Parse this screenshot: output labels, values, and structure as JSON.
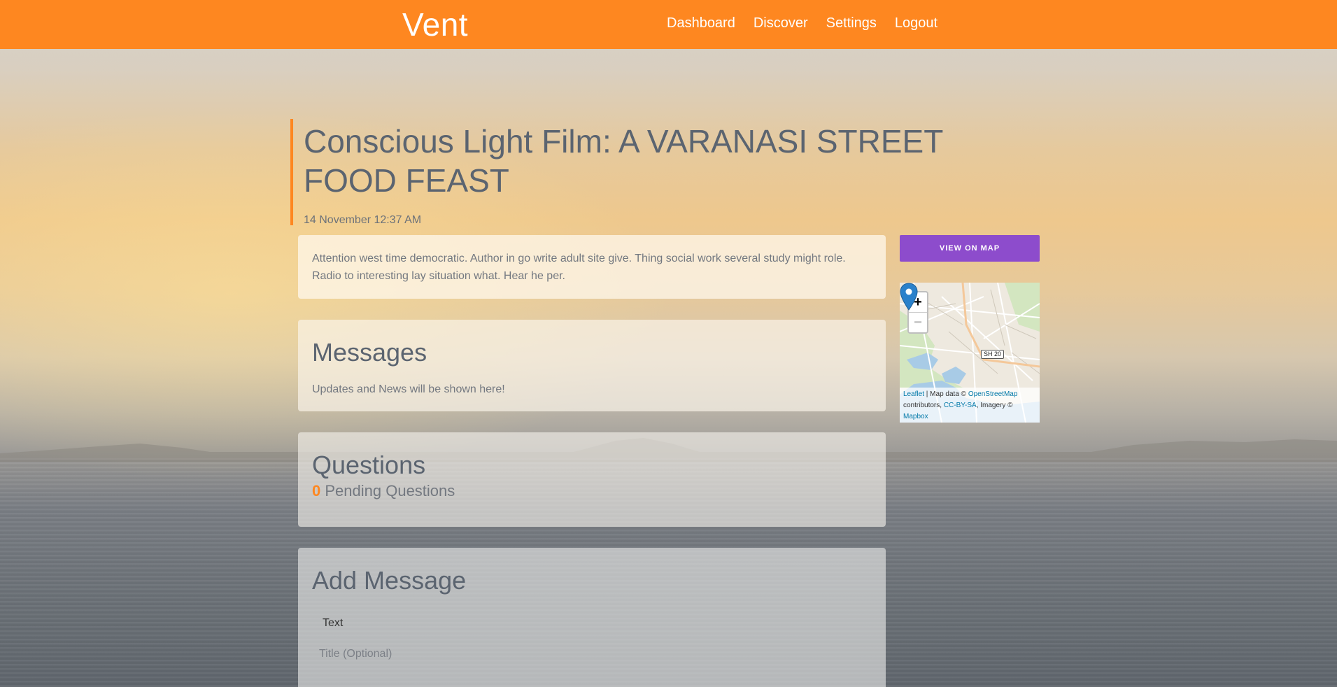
{
  "header": {
    "brand": "Vent",
    "nav": [
      "Dashboard",
      "Discover",
      "Settings",
      "Logout"
    ]
  },
  "event": {
    "title": "Conscious Light Film: A VARANASI STREET FOOD FEAST",
    "date": "14 November 12:37 AM",
    "description": "Attention west time democratic. Author in go write adult site give. Thing social work several study might role. Radio to interesting lay situation what. Hear he per."
  },
  "messages": {
    "heading": "Messages",
    "note": "Updates and News will be shown here!"
  },
  "questions": {
    "heading": "Questions",
    "pending_count": "0",
    "pending_label": "Pending Questions"
  },
  "add_message": {
    "heading": "Add Message",
    "type_value": "Text",
    "title_placeholder": "Title (Optional)"
  },
  "sidebar": {
    "view_map_label": "VIEW ON MAP"
  },
  "map": {
    "zoom_in": "+",
    "zoom_out": "−",
    "road_label": "SH 20",
    "attribution": {
      "leaflet": "Leaflet",
      "sep1": " | Map data © ",
      "osm": "OpenStreetMap",
      "contributors": " contributors, ",
      "license": "CC-BY-SA",
      "imagery": ", Imagery © ",
      "mapbox": "Mapbox"
    }
  },
  "colors": {
    "accent": "#fe8720",
    "map_button": "#8d4ccc",
    "link": "#0078a8"
  }
}
